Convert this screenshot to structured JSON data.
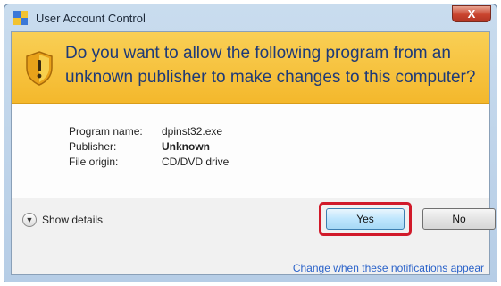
{
  "window": {
    "title": "User Account Control",
    "close_label": "X"
  },
  "banner": {
    "question": "Do you want to allow the following program from an unknown publisher to make changes to this computer?"
  },
  "details": [
    {
      "label": "Program name:",
      "value": "dpinst32.exe",
      "bold": false
    },
    {
      "label": "Publisher:",
      "value": "Unknown",
      "bold": true
    },
    {
      "label": "File origin:",
      "value": "CD/DVD drive",
      "bold": false
    }
  ],
  "footer": {
    "show_details_label": "Show details",
    "yes_label": "Yes",
    "no_label": "No",
    "change_link": "Change when these notifications appear"
  },
  "colors": {
    "banner": "#f4b82c",
    "question_text": "#1e3a78",
    "highlight": "#d11a2a",
    "link": "#2a62c9"
  }
}
